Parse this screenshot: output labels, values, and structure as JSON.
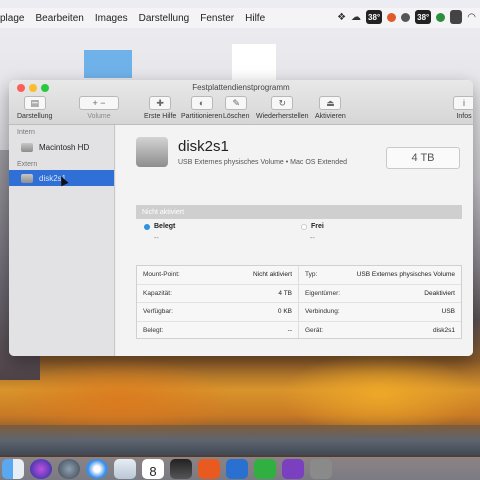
{
  "menubar": {
    "items": [
      "plage",
      "Bearbeiten",
      "Images",
      "Darstellung",
      "Fenster",
      "Hilfe"
    ],
    "tray": [
      "38°",
      "38°"
    ]
  },
  "window": {
    "title": "Festplattendienstprogramm",
    "toolbar": {
      "darstellung": "Darstellung",
      "volume": "Volume",
      "erste_hilfe": "Erste Hilfe",
      "partitionieren": "Partitionieren",
      "loeschen": "Löschen",
      "wiederherstellen": "Wiederherstellen",
      "aktivieren": "Aktivieren",
      "infos": "Infos"
    },
    "sidebar": {
      "intern": "Intern",
      "macintosh": "Macintosh HD",
      "extern": "Extern",
      "disk": "disk2s1"
    },
    "detail": {
      "name": "disk2s1",
      "description": "USB Externes physisches Volume • Mac OS Extended",
      "size": "4 TB",
      "bar_label": "Nicht aktiviert",
      "belegt": "Belegt",
      "belegt_val": "--",
      "frei": "Frei",
      "frei_val": "--",
      "colors": {
        "belegt": "#2f8fe0",
        "frei": "#ffffff"
      }
    },
    "info": {
      "left": [
        {
          "k": "Mount-Point:",
          "v": "Nicht aktiviert"
        },
        {
          "k": "Kapazität:",
          "v": "4 TB"
        },
        {
          "k": "Verfügbar:",
          "v": "0 KB"
        },
        {
          "k": "Belegt:",
          "v": "--"
        }
      ],
      "right": [
        {
          "k": "Typ:",
          "v": "USB Externes physisches Volume"
        },
        {
          "k": "Eigentümer:",
          "v": "Deaktiviert"
        },
        {
          "k": "Verbindung:",
          "v": "USB"
        },
        {
          "k": "Gerät:",
          "v": "disk2s1"
        }
      ]
    }
  },
  "dock": {
    "calendar_day": "8"
  }
}
